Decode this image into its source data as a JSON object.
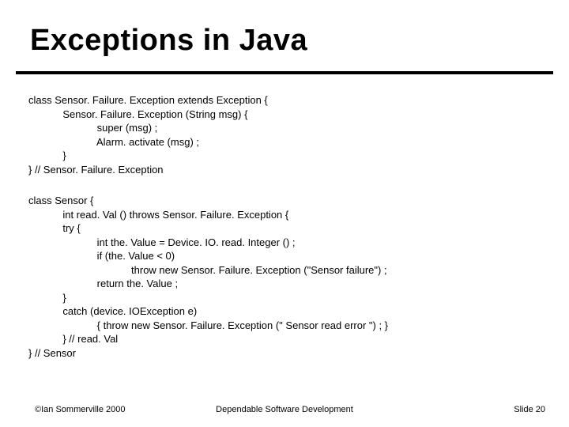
{
  "title": "Exceptions in Java",
  "code_block_1": "class Sensor. Failure. Exception extends Exception {\n            Sensor. Failure. Exception (String msg) {\n                        super (msg) ;\n                        Alarm. activate (msg) ;\n            }\n} // Sensor. Failure. Exception",
  "code_block_2": "class Sensor {\n            int read. Val () throws Sensor. Failure. Exception {\n            try {\n                        int the. Value = Device. IO. read. Integer () ;\n                        if (the. Value < 0)\n                                    throw new Sensor. Failure. Exception (\"Sensor failure\") ;\n                        return the. Value ;\n            }\n            catch (device. IOException e)\n                        { throw new Sensor. Failure. Exception (\" Sensor read error \") ; }\n            } // read. Val\n} // Sensor",
  "footer": {
    "left": "©Ian Sommerville 2000",
    "center": "Dependable Software Development",
    "right": "Slide 20"
  }
}
